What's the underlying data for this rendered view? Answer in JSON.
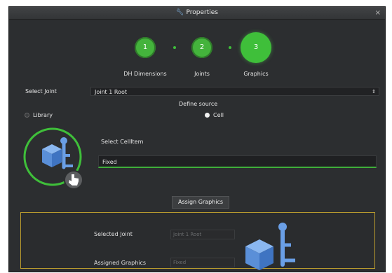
{
  "window": {
    "title": "Properties",
    "close_glyph": "×"
  },
  "steps": [
    {
      "number": "1",
      "label": "DH Dimensions"
    },
    {
      "number": "2",
      "label": "Joints"
    },
    {
      "number": "3",
      "label": "Graphics"
    }
  ],
  "select_joint": {
    "label": "Select Joint",
    "value": "Joint 1 Root"
  },
  "define_source": {
    "title": "Define source",
    "options": [
      {
        "label": "Library",
        "selected": false
      },
      {
        "label": "Cell",
        "selected": true
      }
    ]
  },
  "cell_item": {
    "label": "Select CellItem",
    "value": "Fixed"
  },
  "assign_button": "Assign Graphics",
  "summary": {
    "selected_joint_label": "Selected Joint",
    "selected_joint_value": "Joint 1 Root",
    "assigned_graphics_label": "Assigned Graphics",
    "assigned_graphics_value": "Fixed"
  },
  "colors": {
    "accent_green": "#3fbf3a",
    "icon_blue": "#6a9fe6",
    "panel_border": "#b89a2e"
  },
  "icons": [
    "wrench-icon",
    "close-icon",
    "dropdown-arrow-icon",
    "robot-joint-icon",
    "hand-pointer-icon"
  ]
}
